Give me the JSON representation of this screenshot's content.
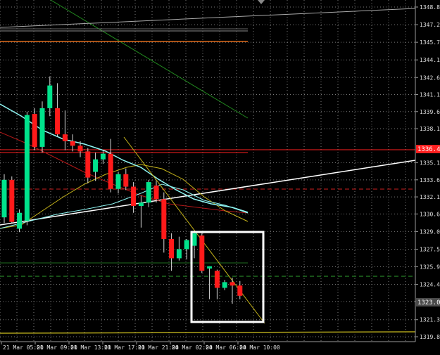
{
  "colors": {
    "background": "#000000",
    "grid": "#7a7a7a",
    "axis": "#9a9a9a",
    "tick_text": "#e0e0e0",
    "bull": "#00e38c",
    "bear": "#ff1a1a",
    "price_line": "#b0b0b0",
    "red_level": "#ff2020",
    "ma_cyan": "#8ef5f2",
    "ma_yellow": "#c6b41a",
    "ma_red": "#b21818",
    "ma_green": "#228a1f",
    "trend_white": "#ffffff",
    "dashed_green": "#2ea02e",
    "dashed_red": "#cc2020",
    "label_red_bg": "#ff2020",
    "label_gray_bg": "#4a4a4a"
  },
  "chart_data": {
    "type": "candlestick",
    "y_ticks": [
      "1348.80",
      "1347.25",
      "1345.70",
      "1344.15",
      "1342.60",
      "1341.10",
      "1339.60",
      "1338.10",
      "1335.10",
      "1333.60",
      "1332.10",
      "1330.60",
      "1329.05",
      "1327.50",
      "1325.95",
      "1324.40",
      "1322.90",
      "1321.30",
      "1319.80"
    ],
    "x_ticks": [
      "21 Mar 05:00",
      "21 Mar 09:00",
      "21 Mar 13:00",
      "21 Mar 17:00",
      "21 Mar 21:00",
      "24 Mar 02:00",
      "24 Mar 06:00",
      "24 Mar 10:00"
    ],
    "ylim": [
      1319.8,
      1348.8
    ],
    "price_labels": {
      "red_level": "1336.41",
      "current": "1323.08"
    },
    "candles": [
      {
        "o": 1330.3,
        "h": 1334.1,
        "l": 1329.8,
        "c": 1333.6
      },
      {
        "o": 1333.6,
        "h": 1333.9,
        "l": 1329.8,
        "c": 1329.9
      },
      {
        "o": 1329.3,
        "h": 1331.0,
        "l": 1329.0,
        "c": 1330.7
      },
      {
        "o": 1330.0,
        "h": 1339.6,
        "l": 1329.6,
        "c": 1339.3
      },
      {
        "o": 1339.4,
        "h": 1339.9,
        "l": 1336.2,
        "c": 1336.5
      },
      {
        "o": 1336.5,
        "h": 1340.5,
        "l": 1336.0,
        "c": 1339.9
      },
      {
        "o": 1339.9,
        "h": 1342.7,
        "l": 1339.2,
        "c": 1341.9
      },
      {
        "o": 1339.9,
        "h": 1342.1,
        "l": 1337.4,
        "c": 1337.6
      },
      {
        "o": 1337.6,
        "h": 1339.7,
        "l": 1336.2,
        "c": 1337.0
      },
      {
        "o": 1337.0,
        "h": 1337.6,
        "l": 1336.1,
        "c": 1336.6
      },
      {
        "o": 1336.6,
        "h": 1337.0,
        "l": 1335.6,
        "c": 1336.1
      },
      {
        "o": 1336.1,
        "h": 1336.4,
        "l": 1333.3,
        "c": 1333.8
      },
      {
        "o": 1334.3,
        "h": 1336.0,
        "l": 1333.5,
        "c": 1335.4
      },
      {
        "o": 1335.4,
        "h": 1336.2,
        "l": 1335.0,
        "c": 1335.9
      },
      {
        "o": 1335.9,
        "h": 1337.2,
        "l": 1332.5,
        "c": 1332.8
      },
      {
        "o": 1332.8,
        "h": 1334.3,
        "l": 1332.4,
        "c": 1334.1
      },
      {
        "o": 1334.1,
        "h": 1334.6,
        "l": 1332.7,
        "c": 1333.0
      },
      {
        "o": 1333.0,
        "h": 1333.4,
        "l": 1330.7,
        "c": 1331.3
      },
      {
        "o": 1331.3,
        "h": 1332.2,
        "l": 1329.4,
        "c": 1331.6
      },
      {
        "o": 1331.6,
        "h": 1333.6,
        "l": 1331.2,
        "c": 1333.4
      },
      {
        "o": 1333.1,
        "h": 1333.5,
        "l": 1331.6,
        "c": 1331.9
      },
      {
        "o": 1331.9,
        "h": 1332.5,
        "l": 1327.2,
        "c": 1328.4
      },
      {
        "o": 1328.4,
        "h": 1328.9,
        "l": 1325.6,
        "c": 1326.7
      },
      {
        "o": 1326.7,
        "h": 1328.6,
        "l": 1326.5,
        "c": 1327.5
      },
      {
        "o": 1327.5,
        "h": 1328.4,
        "l": 1326.6,
        "c": 1328.3
      },
      {
        "o": 1327.8,
        "h": 1328.9,
        "l": 1326.7,
        "c": 1328.9
      },
      {
        "o": 1328.7,
        "h": 1328.9,
        "l": 1325.4,
        "c": 1325.6
      },
      {
        "o": 1325.8,
        "h": 1326.0,
        "l": 1323.1,
        "c": 1326.0
      },
      {
        "o": 1325.6,
        "h": 1325.7,
        "l": 1323.1,
        "c": 1324.1
      },
      {
        "o": 1324.1,
        "h": 1324.8,
        "l": 1323.9,
        "c": 1324.6
      },
      {
        "o": 1324.6,
        "h": 1325.0,
        "l": 1322.7,
        "c": 1324.3
      },
      {
        "o": 1324.3,
        "h": 1324.7,
        "l": 1323.1,
        "c": 1323.4
      }
    ]
  }
}
